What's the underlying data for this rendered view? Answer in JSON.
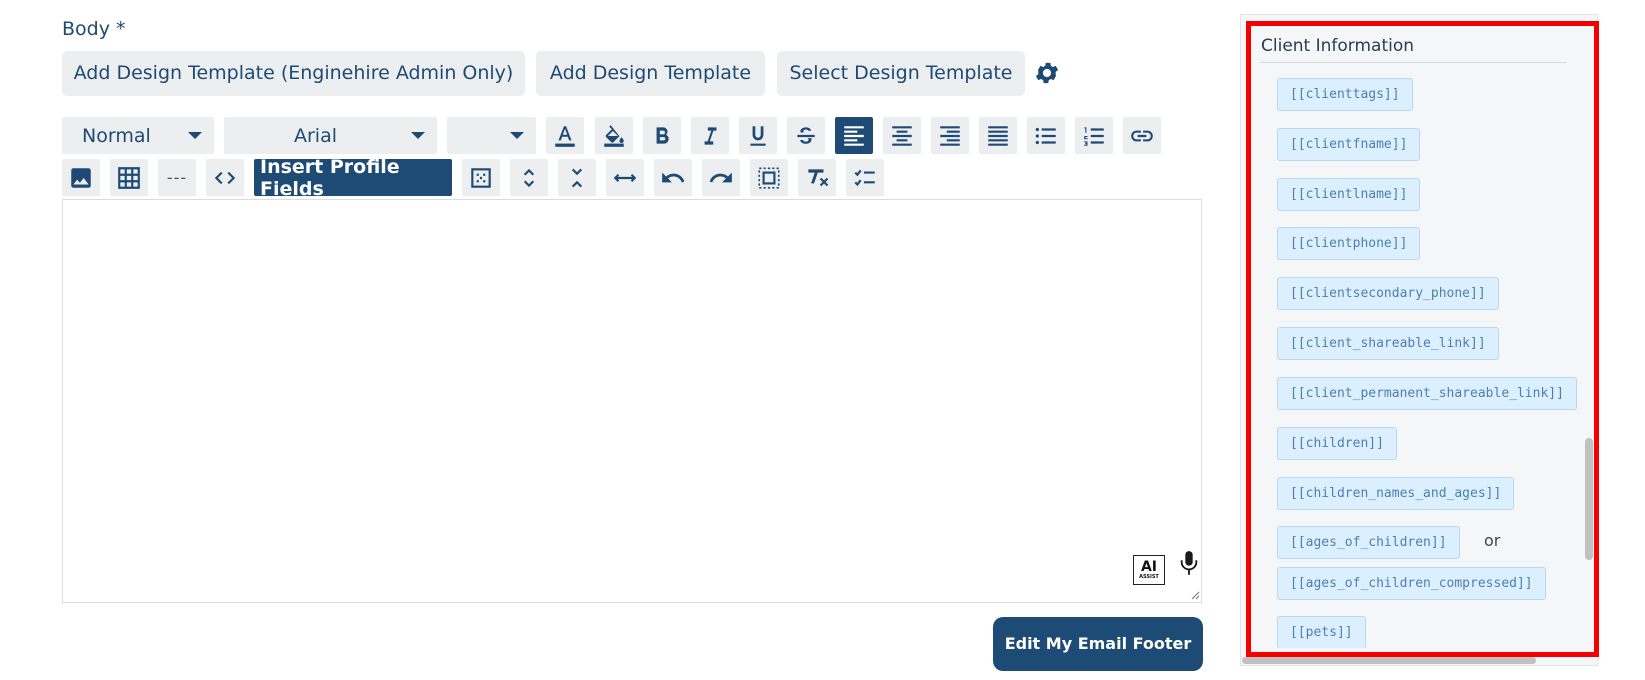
{
  "body_label": "Body *",
  "template_buttons": {
    "admin": "Add Design Template (Enginehire Admin Only)",
    "add": "Add Design Template",
    "select": "Select Design Template"
  },
  "toolbar": {
    "format_value": "Normal",
    "font_value": "Arial",
    "size_value": "",
    "insert_profile_fields": "Insert Profile Fields",
    "hr_label": "---"
  },
  "editor": {
    "ai_label": "AI",
    "assist_label": "ASSIST"
  },
  "footer_button": "Edit My Email Footer",
  "panel": {
    "title": "Client Information",
    "fields": [
      "[[clienttags]]",
      "[[clientfname]]",
      "[[clientlname]]",
      "[[clientphone]]",
      "[[clientsecondary_phone]]",
      "[[client_shareable_link]]",
      "[[client_permanent_shareable_link]]",
      "[[children]]",
      "[[children_names_and_ages]]",
      "[[ages_of_children]]",
      "[[ages_of_children_compressed]]",
      "[[pets]]"
    ],
    "or_text": "or"
  },
  "colors": {
    "accent": "#1e4b75",
    "highlight": "#f40000",
    "chip_bg": "#dcefff",
    "chip_text": "#4a7fb0"
  }
}
